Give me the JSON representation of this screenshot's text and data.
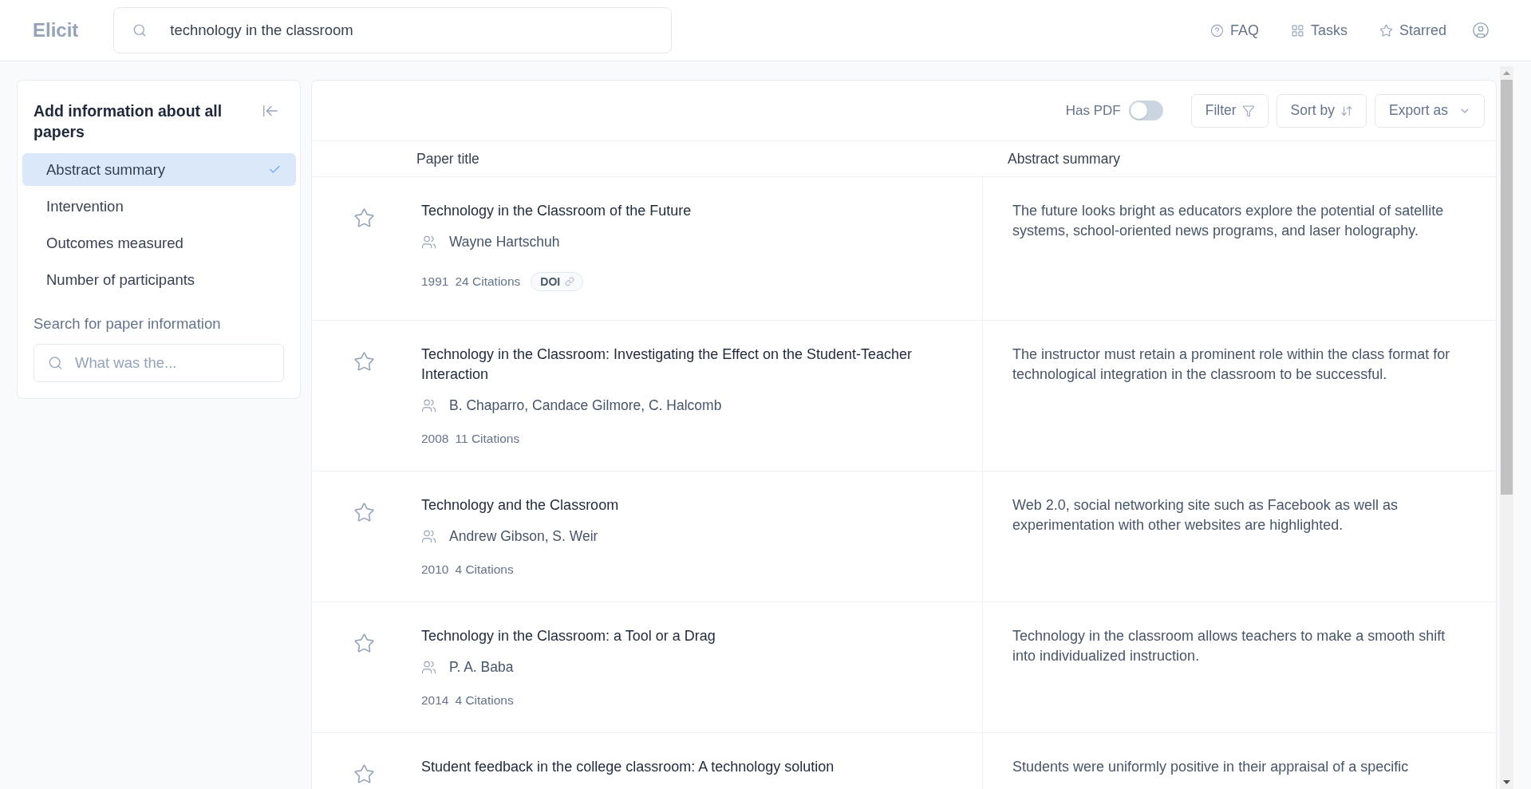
{
  "header": {
    "logo": "Elicit",
    "search": {
      "value": "technology in the classroom"
    },
    "nav": [
      {
        "kind": "help",
        "label": "FAQ"
      },
      {
        "kind": "grid",
        "label": "Tasks"
      },
      {
        "kind": "star",
        "label": "Starred"
      }
    ]
  },
  "sidebar": {
    "title": "Add information about all papers",
    "columns": [
      {
        "label": "Abstract summary",
        "selected": true
      },
      {
        "label": "Intervention",
        "selected": false
      },
      {
        "label": "Outcomes measured",
        "selected": false
      },
      {
        "label": "Number of participants",
        "selected": false
      }
    ],
    "search_label": "Search for paper information",
    "search": {
      "placeholder": "What was the..."
    }
  },
  "toolbar": {
    "has_pdf": {
      "label": "Has PDF",
      "on": false
    },
    "buttons": [
      {
        "kind": "filter",
        "label": "Filter"
      },
      {
        "kind": "sort",
        "label": "Sort by"
      },
      {
        "kind": "export",
        "label": "Export as"
      }
    ]
  },
  "table": {
    "columns": [
      "Paper title",
      "Abstract summary"
    ],
    "rows": [
      {
        "starred": false,
        "title": "Technology in the Classroom of the Future",
        "authors": "Wayne Hartschuh",
        "year": "1991",
        "citations": "24 Citations",
        "doi": "DOI",
        "abstract": "The future looks bright as educators explore the potential of satellite systems, school-oriented news programs, and laser holography."
      },
      {
        "starred": false,
        "title": "Technology in the Classroom: Investigating the Effect on the Student-Teacher Interaction",
        "authors": "B. Chaparro, Candace Gilmore, C. Halcomb",
        "year": "2008",
        "citations": "11 Citations",
        "abstract": "The instructor must retain a prominent role within the class format for technological integration in the classroom to be successful."
      },
      {
        "starred": false,
        "title": "Technology and the Classroom",
        "authors": "Andrew Gibson, S. Weir",
        "year": "2010",
        "citations": "4 Citations",
        "abstract": "Web 2.0, social networking site such as Facebook as well as experimentation with other websites are highlighted."
      },
      {
        "starred": false,
        "title": "Technology in the Classroom: a Tool or a Drag",
        "authors": "P. A. Baba",
        "year": "2014",
        "citations": "4 Citations",
        "abstract": "Technology in the classroom allows teachers to make a smooth shift into individualized instruction."
      },
      {
        "starred": false,
        "title": "Student feedback in the college classroom: A technology solution",
        "abstract": "Students were uniformly positive in their appraisal of a specific"
      }
    ]
  }
}
